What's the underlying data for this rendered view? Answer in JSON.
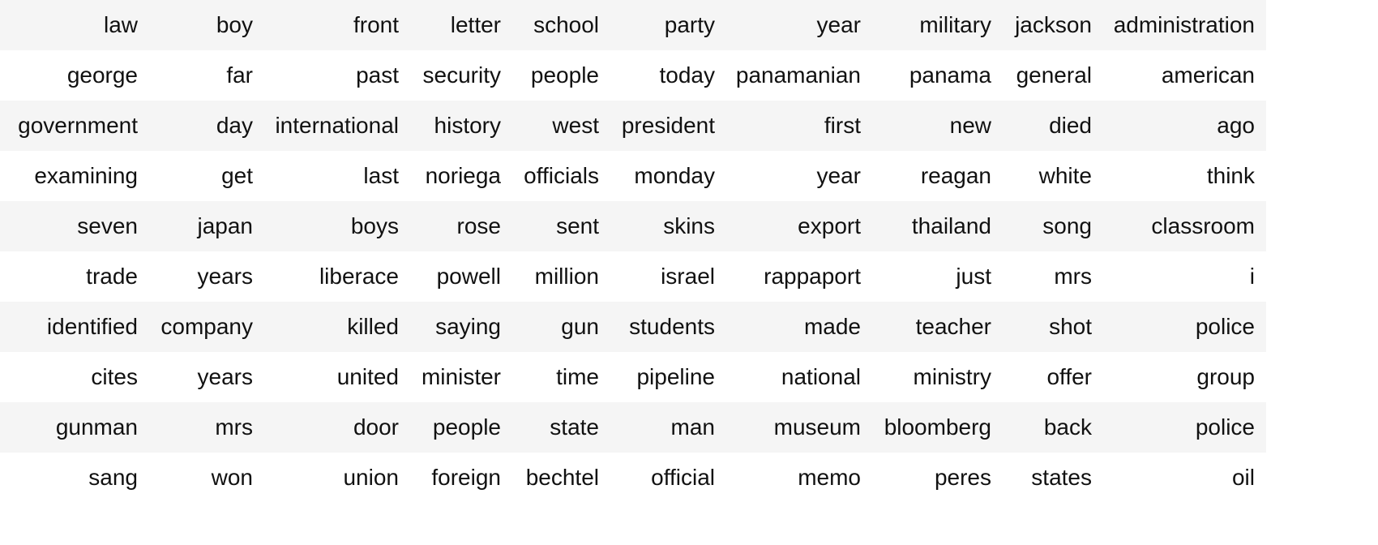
{
  "table": {
    "rows": [
      [
        "law",
        "boy",
        "front",
        "letter",
        "school",
        "party",
        "year",
        "military",
        "jackson",
        "administration"
      ],
      [
        "george",
        "far",
        "past",
        "security",
        "people",
        "today",
        "panamanian",
        "panama",
        "general",
        "american"
      ],
      [
        "government",
        "day",
        "international",
        "history",
        "west",
        "president",
        "first",
        "new",
        "died",
        "ago"
      ],
      [
        "examining",
        "get",
        "last",
        "noriega",
        "officials",
        "monday",
        "year",
        "reagan",
        "white",
        "think"
      ],
      [
        "seven",
        "japan",
        "boys",
        "rose",
        "sent",
        "skins",
        "export",
        "thailand",
        "song",
        "classroom"
      ],
      [
        "trade",
        "years",
        "liberace",
        "powell",
        "million",
        "israel",
        "rappaport",
        "just",
        "mrs",
        "i"
      ],
      [
        "identified",
        "company",
        "killed",
        "saying",
        "gun",
        "students",
        "made",
        "teacher",
        "shot",
        "police"
      ],
      [
        "cites",
        "years",
        "united",
        "minister",
        "time",
        "pipeline",
        "national",
        "ministry",
        "offer",
        "group"
      ],
      [
        "gunman",
        "mrs",
        "door",
        "people",
        "state",
        "man",
        "museum",
        "bloomberg",
        "back",
        "police"
      ],
      [
        "sang",
        "won",
        "union",
        "foreign",
        "bechtel",
        "official",
        "memo",
        "peres",
        "states",
        "oil"
      ]
    ]
  }
}
